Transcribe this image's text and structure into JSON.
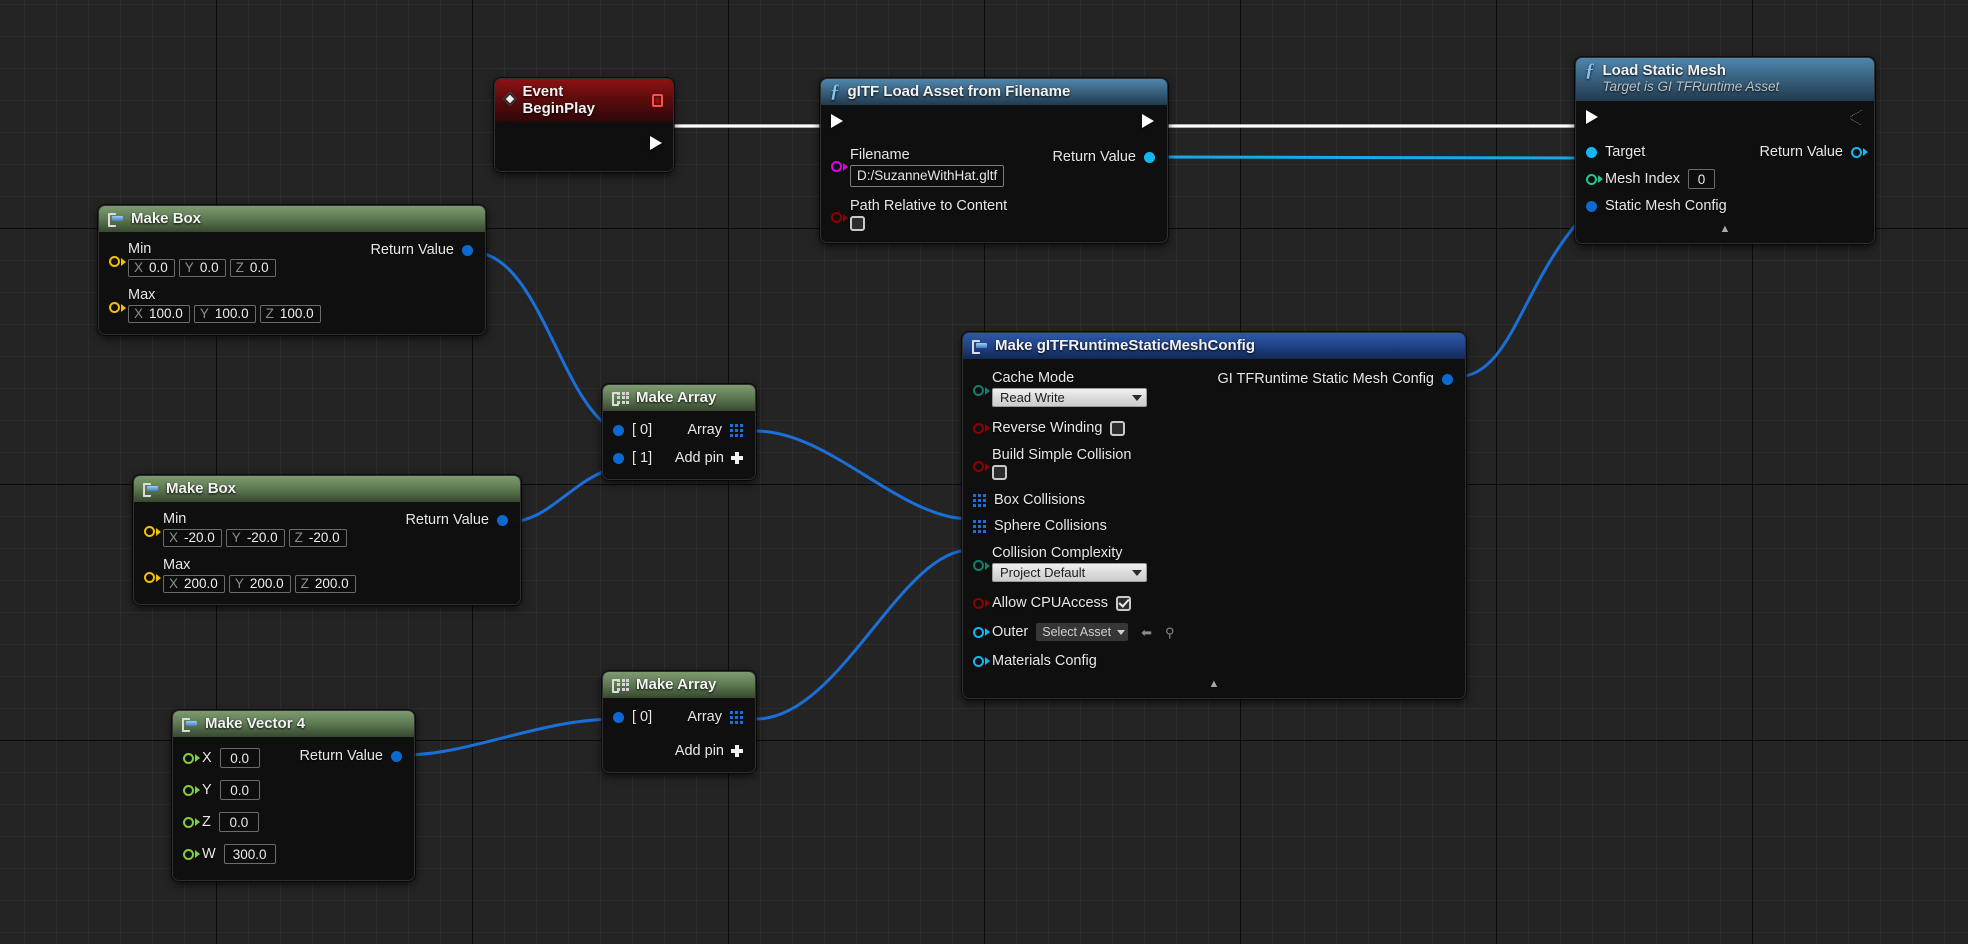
{
  "graph": {
    "background_color": "#242424",
    "grid_minor_color": "#2e2e2e",
    "grid_major_color": "#000000"
  },
  "nodes": {
    "event_begin_play": {
      "title": "Event BeginPlay",
      "icon": "event-diamond-icon",
      "stop_button": "stop-icon",
      "title_color": "#8d1213",
      "exec_out": ""
    },
    "gltf_load_asset": {
      "title": "gITF Load Asset from Filename",
      "icon": "function-f-icon",
      "title_color": "#4f86ad",
      "pins": {
        "filename_label": "Filename",
        "filename_value": "D:/SuzanneWithHat.gltf",
        "path_relative_label": "Path Relative to Content",
        "path_relative_checked": false,
        "return_value_label": "Return Value"
      }
    },
    "load_static_mesh": {
      "title": "Load Static Mesh",
      "subtitle": "Target is GI TFRuntime Asset",
      "icon": "function-f-icon",
      "title_color": "#4f86ad",
      "pins": {
        "target_label": "Target",
        "mesh_index_label": "Mesh Index",
        "mesh_index_value": "0",
        "static_mesh_config_label": "Static Mesh Config",
        "return_value_label": "Return Value"
      },
      "collapse": "▲"
    },
    "make_box_1": {
      "title": "Make Box",
      "icon": "make-struct-icon",
      "title_color": "#7e9a70",
      "pins": {
        "min_label": "Min",
        "min": [
          {
            "axis": "X",
            "value": "0.0"
          },
          {
            "axis": "Y",
            "value": "0.0"
          },
          {
            "axis": "Z",
            "value": "0.0"
          }
        ],
        "max_label": "Max",
        "max": [
          {
            "axis": "X",
            "value": "100.0"
          },
          {
            "axis": "Y",
            "value": "100.0"
          },
          {
            "axis": "Z",
            "value": "100.0"
          }
        ],
        "return_value_label": "Return Value"
      }
    },
    "make_box_2": {
      "title": "Make Box",
      "icon": "make-struct-icon",
      "title_color": "#7e9a70",
      "pins": {
        "min_label": "Min",
        "min": [
          {
            "axis": "X",
            "value": "-20.0"
          },
          {
            "axis": "Y",
            "value": "-20.0"
          },
          {
            "axis": "Z",
            "value": "-20.0"
          }
        ],
        "max_label": "Max",
        "max": [
          {
            "axis": "X",
            "value": "200.0"
          },
          {
            "axis": "Y",
            "value": "200.0"
          },
          {
            "axis": "Z",
            "value": "200.0"
          }
        ],
        "return_value_label": "Return Value"
      }
    },
    "make_vector_4": {
      "title": "Make Vector 4",
      "icon": "make-struct-icon",
      "title_color": "#7e9a70",
      "pins": {
        "components": [
          {
            "axis": "X",
            "value": "0.0"
          },
          {
            "axis": "Y",
            "value": "0.0"
          },
          {
            "axis": "Z",
            "value": "0.0"
          },
          {
            "axis": "W",
            "value": "300.0"
          }
        ],
        "return_value_label": "Return Value"
      }
    },
    "make_array_1": {
      "title": "Make Array",
      "icon": "make-array-icon",
      "title_color": "#7e9a70",
      "pins": {
        "items": [
          "[ 0]",
          "[ 1]"
        ],
        "array_label": "Array",
        "add_pin_label": "Add pin"
      }
    },
    "make_array_2": {
      "title": "Make Array",
      "icon": "make-array-icon",
      "title_color": "#7e9a70",
      "pins": {
        "items": [
          "[ 0]"
        ],
        "array_label": "Array",
        "add_pin_label": "Add pin"
      }
    },
    "make_static_mesh_config": {
      "title": "Make gITFRuntimeStaticMeshConfig",
      "icon": "make-struct-icon",
      "title_color": "#2e59a8",
      "pins": {
        "cache_mode_label": "Cache Mode",
        "cache_mode_value": "Read Write",
        "reverse_winding_label": "Reverse Winding",
        "reverse_winding_checked": false,
        "build_simple_collision_label": "Build Simple Collision",
        "build_simple_collision_checked": false,
        "box_collisions_label": "Box Collisions",
        "sphere_collisions_label": "Sphere Collisions",
        "collision_complexity_label": "Collision Complexity",
        "collision_complexity_value": "Project Default",
        "allow_cpu_access_label": "Allow CPUAccess",
        "allow_cpu_access_checked": true,
        "outer_label": "Outer",
        "outer_value": "Select Asset",
        "materials_config_label": "Materials Config",
        "output_label": "GI TFRuntime Static Mesh Config"
      },
      "collapse": "▲"
    }
  },
  "pin_colors": {
    "exec": "#ffffff",
    "string": "#e300e3",
    "bool": "#8c0000",
    "struct": "#0a6ad1",
    "object": "#16b6f0",
    "int": "#1ec98c",
    "enum": "#117d6e",
    "float": "#7ad13a",
    "vector": "#f2c000",
    "wire_data": "#1a70d8",
    "wire_exec": "#ffffff"
  }
}
